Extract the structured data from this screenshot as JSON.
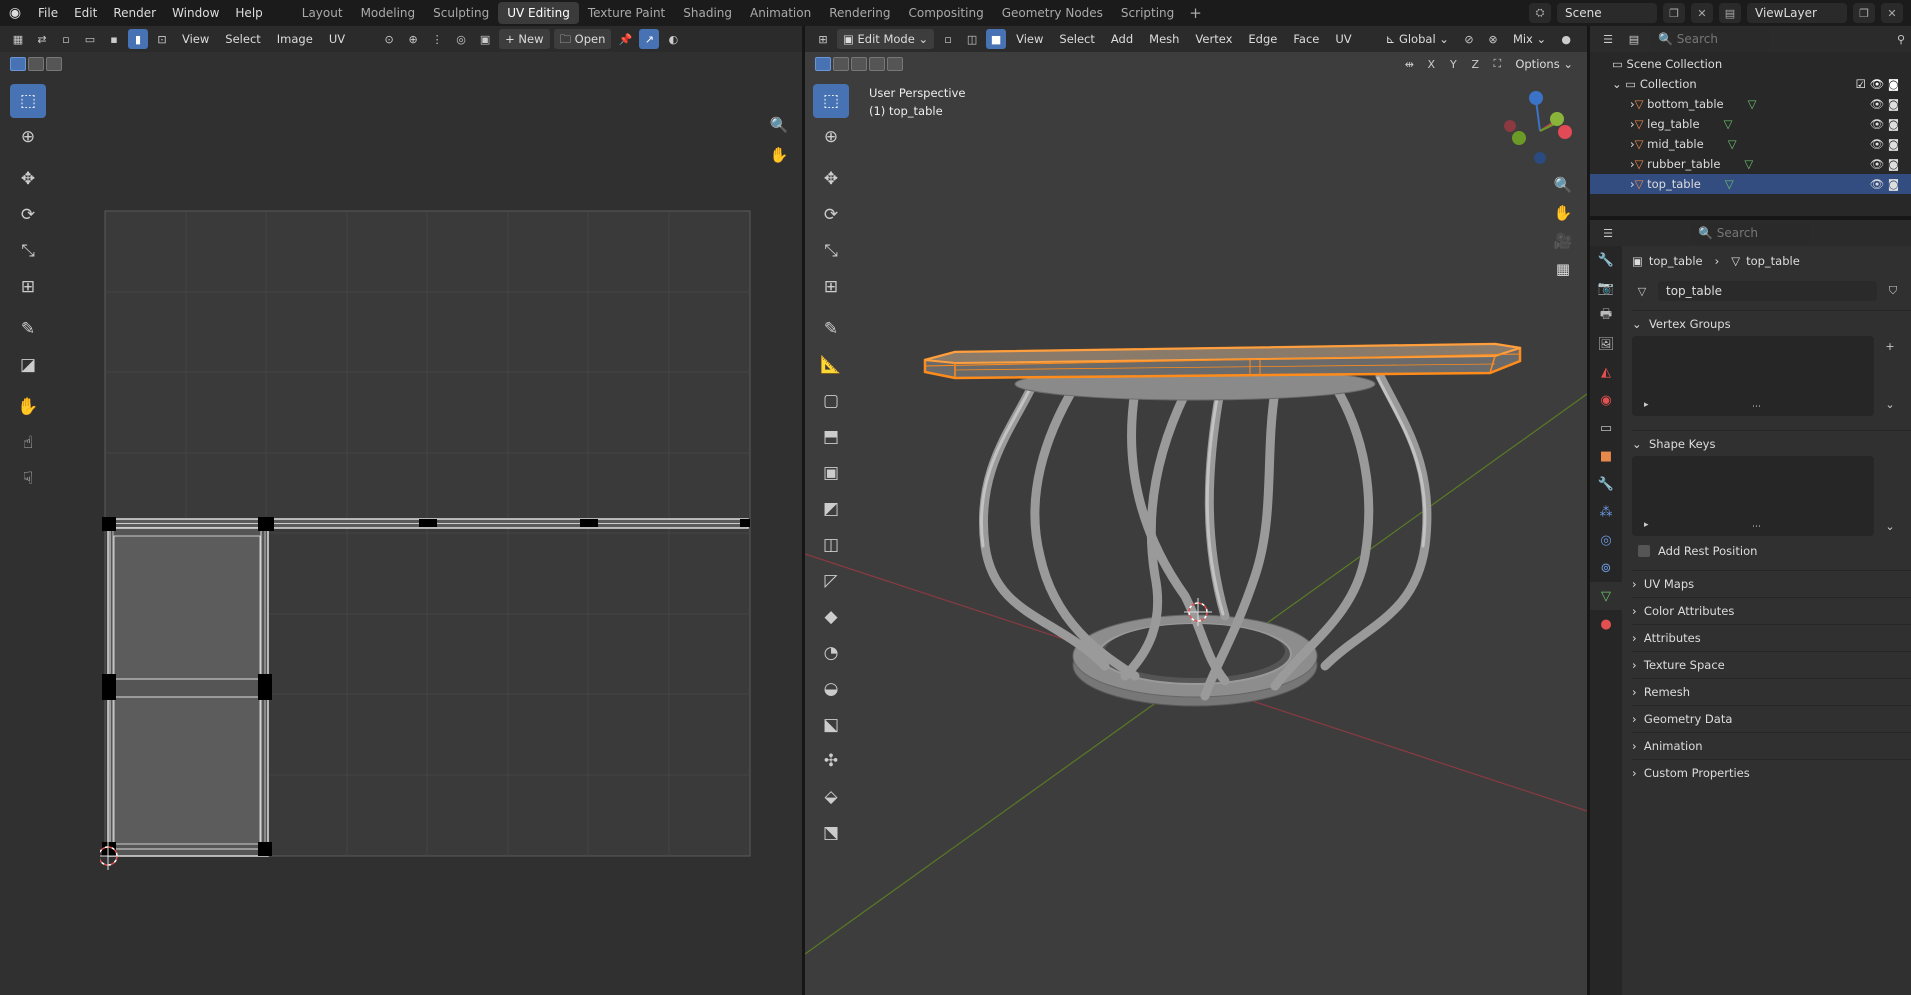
{
  "menu": [
    "File",
    "Edit",
    "Render",
    "Window",
    "Help"
  ],
  "workspaces": [
    "Layout",
    "Modeling",
    "Sculpting",
    "UV Editing",
    "Texture Paint",
    "Shading",
    "Animation",
    "Rendering",
    "Compositing",
    "Geometry Nodes",
    "Scripting"
  ],
  "active_workspace": "UV Editing",
  "scene": {
    "label": "Scene",
    "viewlayer": "ViewLayer"
  },
  "uv": {
    "menus": [
      "View",
      "Select",
      "Image",
      "UV"
    ],
    "new_label": "New",
    "open_label": "Open"
  },
  "viewport": {
    "mode": "Edit Mode",
    "menus": [
      "View",
      "Select",
      "Add",
      "Mesh",
      "Vertex",
      "Edge",
      "Face",
      "UV"
    ],
    "orientation": "Global",
    "shading": "Mix",
    "options_label": "Options",
    "axis_x": "X",
    "axis_y": "Y",
    "axis_z": "Z",
    "overlay_line1": "User Perspective",
    "overlay_line2": "(1) top_table"
  },
  "outliner": {
    "search_placeholder": "Search",
    "root": "Scene Collection",
    "collection": "Collection",
    "items": [
      "bottom_table",
      "leg_table",
      "mid_table",
      "rubber_table",
      "top_table"
    ],
    "selected": "top_table"
  },
  "properties": {
    "search_placeholder": "Search",
    "breadcrumb_object": "top_table",
    "breadcrumb_mesh": "top_table",
    "mesh_name": "top_table",
    "sections": [
      "Vertex Groups",
      "Shape Keys",
      "UV Maps",
      "Color Attributes",
      "Attributes",
      "Texture Space",
      "Remesh",
      "Geometry Data",
      "Animation",
      "Custom Properties"
    ],
    "add_rest_position": "Add Rest Position"
  },
  "colors": {
    "accent": "#4772b3",
    "selection_orange": "#ff8c1a",
    "x_axis": "#b8474f",
    "y_axis": "#6c9a27",
    "z_axis": "#3a73c7"
  }
}
